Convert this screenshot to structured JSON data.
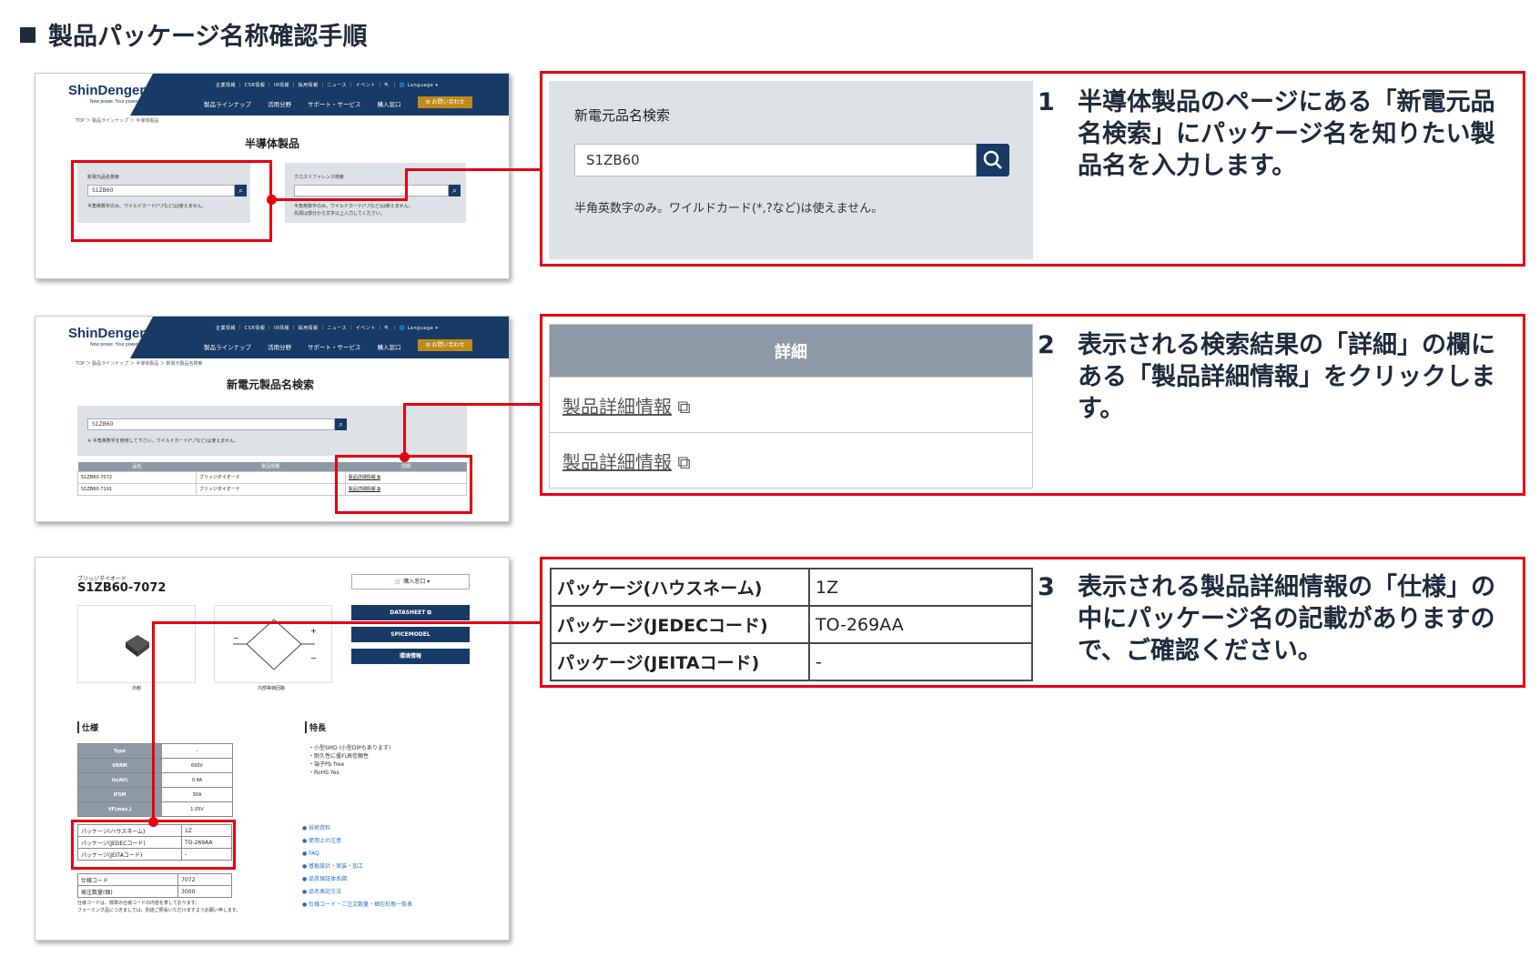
{
  "page_title": "製品パッケージ名称確認手順",
  "site": {
    "logo": "ShinDengen",
    "tagline": "Now power. Your power.",
    "top_nav": "企業情報 ｜ CSR情報 ｜ IR情報 ｜ 採用情報 ｜ ニュース ｜ イベント ｜ 🔍 ｜ 🌐 Language ▾",
    "menu": [
      "製品ラインナップ",
      "活用分野",
      "サポート・サービス",
      "購入窓口"
    ],
    "contact": "⚙ お問い合わせ"
  },
  "step1": {
    "num": "1",
    "text": "半導体製品のページにある「新電元品名検索」にパッケージ名を知りたい製品名を入力します。",
    "thumb": {
      "breadcrumb": "TOP ＞ 製品ラインナップ ＞ 半導体製品",
      "heading": "半導体製品",
      "search_label": "新電元品名検索",
      "search_value": "S1ZB60",
      "search_note": "半角英数字のみ。ワイルドカード(*,?など)は使えません。",
      "cross_label": "クロスリファレンス検索",
      "cross_note1": "半角英数字のみ。ワイルドカード(*,?など)は使えません。",
      "cross_note2": "先頭は部分から文字以上入力してください。"
    },
    "panel": {
      "label": "新電元品名検索",
      "value": "S1ZB60",
      "note": "半角英数字のみ。ワイルドカード(*,?など)は使えません。"
    }
  },
  "step2": {
    "num": "2",
    "text": "表示される検索結果の「詳細」の欄にある「製品詳細情報」をクリックします。",
    "thumb": {
      "breadcrumb": "TOP ＞ 製品ラインナップ ＞ 半導体製品 ＞ 新電元製品名検索",
      "heading": "新電元製品名検索",
      "search_value": "S1ZB60",
      "note": "※ 半角英数字を使用して下さい。ワイルドカード(*,?など)は使えません。",
      "headers": [
        "品名",
        "製品情報",
        "詳細"
      ],
      "rows": [
        [
          "S1ZB60-7072",
          "ブリッジダイオード",
          "製品詳細情報 ⧉"
        ],
        [
          "S1ZB60-7101",
          "ブリッジダイオード",
          "製品詳細情報 ⧉"
        ]
      ]
    },
    "panel": {
      "header": "詳細",
      "link1": "製品詳細情報",
      "link2": "製品詳細情報"
    }
  },
  "step3": {
    "num": "3",
    "text": "表示される製品詳細情報の「仕様」の中にパッケージ名の記載がありますので、ご確認ください。",
    "thumb": {
      "category": "ブリッジダイオード",
      "product": "S1ZB60-7072",
      "buy": "🛒 購入窓口",
      "buttons": [
        "DATASHEET ⧉",
        "SPICEMODEL",
        "環境情報"
      ],
      "caption_outer": "外観",
      "caption_inner": "内部等価回路",
      "spec_title": "仕様",
      "feature_title": "特長",
      "features": [
        "・小型SMD (小型DIPもあります)",
        "・耐久性に優れ高信頼性",
        "・端子Pb free",
        "・RoHS:Yes"
      ],
      "spec_rows": [
        [
          "Type",
          "-"
        ],
        [
          "VRRM",
          "600V"
        ],
        [
          "Io(AV)",
          "0.8A"
        ],
        [
          "IFSM",
          "30A"
        ],
        [
          "VF(max.)",
          "1.05V"
        ]
      ],
      "pkg_rows": [
        [
          "パッケージ(ハウスネーム)",
          "1Z"
        ],
        [
          "パッケージ(JEDECコード)",
          "TO-269AA"
        ],
        [
          "パッケージ(JEITAコード)",
          "-"
        ]
      ],
      "extra_rows": [
        [
          "仕様コード",
          "7072"
        ],
        [
          "発注数量(個)",
          "3000"
        ]
      ],
      "footnote1": "仕様コードは、標準の仕様コードの内容を表しております。",
      "footnote2": "フォーミング品につきましては、別途ご照会いただけますようお願い申します。",
      "links": [
        "技術資料",
        "使用上の注意",
        "FAQ",
        "基板設計・実装・加工",
        "品質保証体系図",
        "品名表記方法",
        "仕様コード・ご注文数量・梱包形態一覧表"
      ]
    },
    "panel": {
      "rows": [
        [
          "パッケージ(ハウスネーム)",
          "1Z"
        ],
        [
          "パッケージ(JEDECコード)",
          "TO-269AA"
        ],
        [
          "パッケージ(JEITAコード)",
          "-"
        ]
      ]
    }
  },
  "colors": {
    "accent_red": "#e60012",
    "navy": "#173a66",
    "gray_panel": "#dde2e7",
    "table_header": "#8d9aa6"
  }
}
